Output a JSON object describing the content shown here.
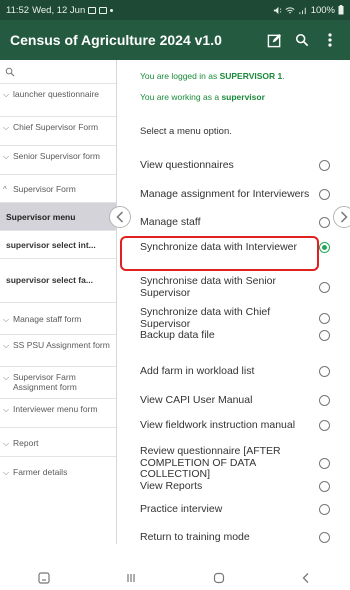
{
  "status_bar": {
    "time": "11:52",
    "date": "Wed, 12 Jun",
    "battery": "100%"
  },
  "app_bar": {
    "title": "Census of Agriculture 2024 v1.0",
    "edit_icon": "edit-square-icon",
    "search_icon": "search-icon",
    "menu_icon": "more-vert-icon"
  },
  "sidebar": {
    "search_icon": "search-icon",
    "items": [
      {
        "label": "launcher questionnaire",
        "chevron": "⌵"
      },
      {
        "label": "Chief Supervisor Form",
        "chevron": "⌵"
      },
      {
        "label": "Senior Supervisor form",
        "chevron": "⌵"
      },
      {
        "label": "Supervisor Form",
        "chevron": "^"
      },
      {
        "label": "Supervisor menu"
      },
      {
        "label": "supervisor select int..."
      },
      {
        "label": "supervisor select fa..."
      },
      {
        "label": "Manage staff form",
        "chevron": "⌵"
      },
      {
        "label": "SS PSU Assignment form",
        "chevron": "⌵"
      },
      {
        "label": "Supervisor Farm Assignment form",
        "chevron": "⌵"
      },
      {
        "label": "Interviewer menu form",
        "chevron": "⌵"
      },
      {
        "label": "Report",
        "chevron": "⌵"
      },
      {
        "label": "Farmer details",
        "chevron": "⌵"
      }
    ]
  },
  "main": {
    "login_prefix": "You are logged in as ",
    "login_user": "SUPERVISOR 1",
    "login_suffix": ".",
    "working_prefix": "You are working as a ",
    "working_role": "supervisor",
    "prompt": "Select a menu option.",
    "options": [
      {
        "label": "View questionnaires",
        "selected": false
      },
      {
        "label": "Manage assignment for Interviewers",
        "selected": false
      },
      {
        "label": "Manage staff",
        "selected": false
      },
      {
        "label": "Synchronize data with Interviewer",
        "selected": true
      },
      {
        "label": "Synchronise data with Senior Supervisor",
        "selected": false
      },
      {
        "label": "Synchronize data with Chief Supervisor",
        "selected": false
      },
      {
        "label": "Backup data file",
        "selected": false
      },
      {
        "label": "Add farm in workload list",
        "selected": false
      },
      {
        "label": "View CAPI User Manual",
        "selected": false
      },
      {
        "label": "View fieldwork instruction manual",
        "selected": false
      },
      {
        "label": "Review questionnaire [AFTER COMPLETION OF DATA COLLECTION]",
        "selected": false
      },
      {
        "label": "View Reports",
        "selected": false
      },
      {
        "label": "Practice interview",
        "selected": false
      },
      {
        "label": "Return to training mode",
        "selected": false
      }
    ]
  },
  "colors": {
    "app_bar": "#245a3f",
    "status_bar": "#1e4a35",
    "accent_green": "#1a8a3a",
    "radio_selected": "#26a65b",
    "highlight_border": "#e0201e"
  }
}
